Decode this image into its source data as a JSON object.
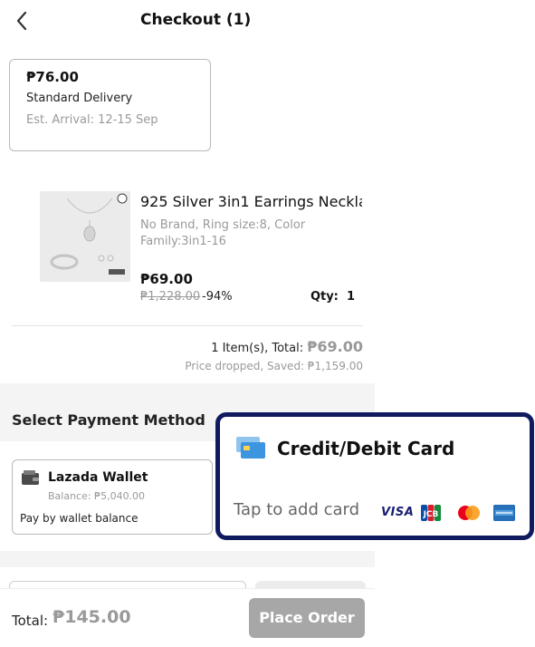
{
  "header": {
    "title": "Checkout (1)"
  },
  "delivery": {
    "price": "₱76.00",
    "type": "Standard Delivery",
    "eta": "Est. Arrival: 12-15 Sep"
  },
  "product": {
    "name": "925 Silver 3in1 Earrings Neckla...",
    "variant": "No Brand, Ring size:8, Color Family:3in1-16",
    "price": "₱69.00",
    "original_price": "₱1,228.00",
    "discount": "-94%",
    "qty_label": "Qty:",
    "qty": "1"
  },
  "summary": {
    "items_total_label": "1 Item(s), Total:",
    "items_total_value": "₱69.00",
    "saved_text": "Price dropped, Saved:  ₱1,159.00"
  },
  "payment": {
    "title": "Select Payment Method",
    "wallet": {
      "name": "Lazada Wallet",
      "balance": "Balance: ₱5,040.00",
      "description": "Pay by wallet balance"
    },
    "card": {
      "title": "Credit/Debit Card",
      "tap_text": "Tap to add card",
      "logos": [
        "VISA",
        "JCB",
        "Mastercard",
        "American Express"
      ],
      "visa_text": "VISA",
      "highlight_color": "#101a5f"
    }
  },
  "footer": {
    "total_label": "Total:",
    "total_value": "₱145.00",
    "place_order_label": "Place Order"
  },
  "icons": {
    "back": "chevron-left-icon",
    "wallet": "wallet-icon",
    "card": "credit-card-icon"
  }
}
